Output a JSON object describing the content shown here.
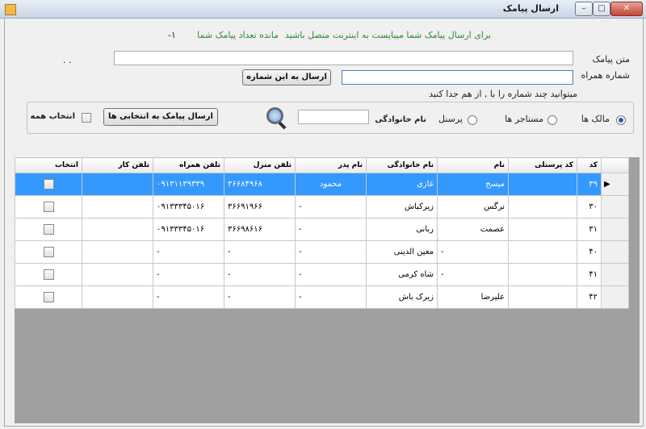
{
  "window": {
    "title": "ارسال پیامک"
  },
  "header": {
    "internet_notice": "برای ارسال پیامک شما میبایست به اینترنت متصل باشید",
    "remaining_label": "مانده تعداد پیامک شما",
    "remaining_value": "-۱"
  },
  "form": {
    "message_label": "متن پیامک",
    "message_value": "",
    "dots": ". .",
    "phone_label": "شماره همراه",
    "phone_value": "",
    "send_this_button": "ارسال به این شماره",
    "multi_hint": "میتوانید چند شماره را با , از هم جدا کنید"
  },
  "filter": {
    "radio_owners": "مالک ها",
    "radio_tenants": "مستاجر ها",
    "radio_staff": "پرسنل",
    "family_label": "نام خانوادگی",
    "family_value": "",
    "send_selected_button": "ارسال پیامک به انتخابی ها",
    "select_all_label": "انتخاب همه"
  },
  "table": {
    "columns": [
      "کد",
      "کد پرسنلی",
      "نام",
      "نام خانوادگی",
      "نام پدر",
      "تلفن منزل",
      "تلفن همراه",
      "تلفن کار",
      "انتخاب"
    ],
    "rows": [
      {
        "code": "۳۹",
        "personnel": "",
        "name": "میسح",
        "family": "غازی",
        "father": "محمود",
        "home": "۳۶۶۸۴۹۶۸",
        "mobile": "۰۹۱۳۱۱۳۹۳۳۹",
        "work": ""
      },
      {
        "code": "۳۰",
        "personnel": "",
        "name": "نرگس",
        "family": "زیرکباش",
        "father": "-",
        "home": "۳۶۶۹۱۹۶۶",
        "mobile": "۰۹۱۳۳۳۴۵۰۱۶",
        "work": ""
      },
      {
        "code": "۳۱",
        "personnel": "",
        "name": "عصمت",
        "family": "ربانی",
        "father": "-",
        "home": "۳۶۶۹۸۶۱۶",
        "mobile": "۰۹۱۳۳۳۴۵۰۱۶",
        "work": ""
      },
      {
        "code": "۴۰",
        "personnel": "",
        "name": "-",
        "family": "معین الدینی",
        "father": "-",
        "home": "-",
        "mobile": "-",
        "work": ""
      },
      {
        "code": "۴۱",
        "personnel": "",
        "name": "-",
        "family": "شاه کرمی",
        "father": "-",
        "home": "-",
        "mobile": "-",
        "work": ""
      },
      {
        "code": "۴۲",
        "personnel": "",
        "name": "علیرضا",
        "family": "زیرک باش",
        "father": "-",
        "home": "-",
        "mobile": "-",
        "work": ""
      }
    ]
  },
  "colors": {
    "selection": "#3399ff",
    "notice_green": "#2f8a2f",
    "grid_background": "#a0a0a0"
  }
}
